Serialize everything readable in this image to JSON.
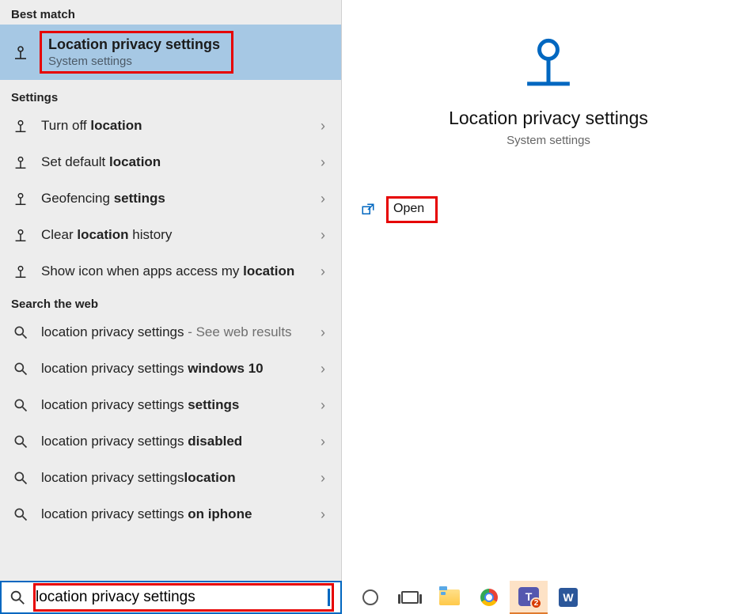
{
  "left": {
    "best_match_header": "Best match",
    "best_match": {
      "title": "Location privacy settings",
      "subtitle": "System settings"
    },
    "settings_header": "Settings",
    "settings_items": [
      {
        "pre": "Turn off ",
        "bold": "location",
        "post": ""
      },
      {
        "pre": "Set default ",
        "bold": "location",
        "post": ""
      },
      {
        "pre": "Geofencing ",
        "bold": "settings",
        "post": ""
      },
      {
        "pre": "Clear ",
        "bold": "location",
        "post": " history"
      },
      {
        "pre": "Show icon when apps access my ",
        "bold": "location",
        "post": ""
      }
    ],
    "web_header": "Search the web",
    "web_items": [
      {
        "text": "location privacy settings",
        "suffix": " - See web results",
        "bold_tail": ""
      },
      {
        "text": "location privacy settings ",
        "suffix": "",
        "bold_tail": "windows 10"
      },
      {
        "text": "location privacy settings ",
        "suffix": "",
        "bold_tail": "settings"
      },
      {
        "text": "location privacy settings ",
        "suffix": "",
        "bold_tail": "disabled"
      },
      {
        "text": "location privacy settings",
        "suffix": "",
        "bold_tail": "location"
      },
      {
        "text": "location privacy settings ",
        "suffix": "",
        "bold_tail": "on iphone"
      }
    ]
  },
  "right": {
    "title": "Location privacy settings",
    "subtitle": "System settings",
    "open_label": "Open"
  },
  "search": {
    "value": "location privacy settings"
  },
  "taskbar": {
    "teams_badge": "2",
    "teams_letter": "T",
    "word_letter": "W"
  }
}
